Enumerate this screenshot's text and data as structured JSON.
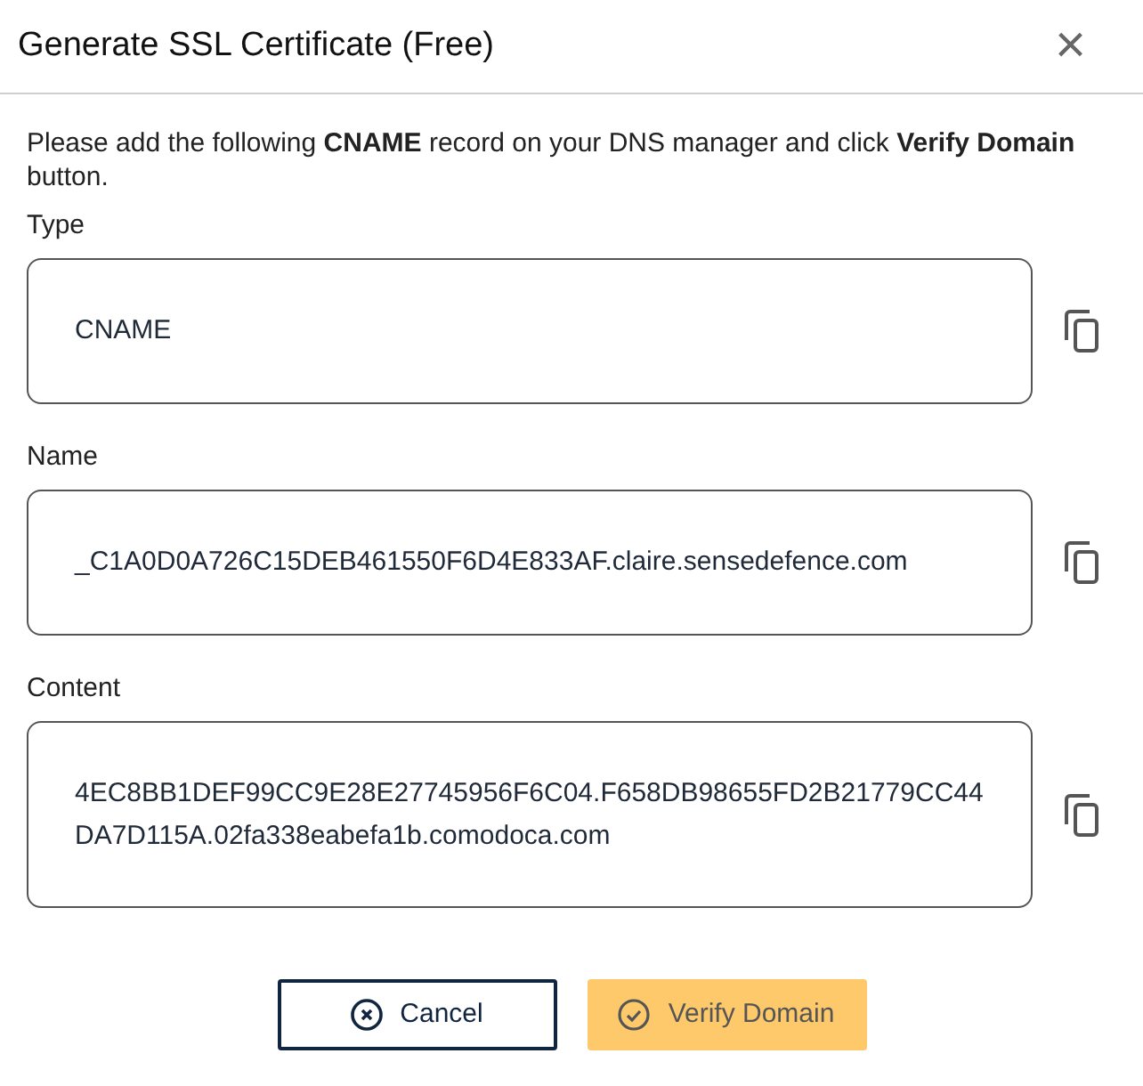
{
  "dialog": {
    "title": "Generate SSL Certificate (Free)",
    "close": "×"
  },
  "instructions": "Please add the following **CNAME** record on your DNS manager and click **Verify Domain** button.",
  "fields": [
    {
      "label": "Type",
      "value": "CNAME"
    },
    {
      "label": "Name",
      "value": "_C1A0D0A726C15DEB461550F6D4E833AF.claire.sensedefence.com"
    },
    {
      "label": "Content",
      "value": "4EC8BB1DEF99CC9E28E27745956F6C04.F658DB98655FD2B21779CC44DA7D115A.02fa338eabefa1b.comodoca.com"
    }
  ],
  "buttons": [
    {
      "kind": "cancel",
      "label": "Cancel",
      "disabled": false
    },
    {
      "kind": "verify",
      "label": "Verify Domain",
      "disabled": true
    }
  ]
}
